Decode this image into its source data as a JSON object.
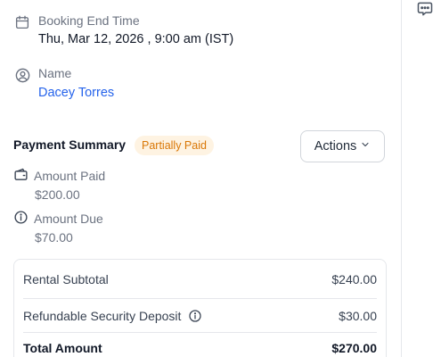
{
  "booking": {
    "end_time_label": "Booking End Time",
    "end_time_value": "Thu, Mar 12, 2026 , 9:00 am (IST)",
    "name_label": "Name",
    "name_value": "Dacey Torres"
  },
  "payment_summary": {
    "title": "Payment Summary",
    "status_badge": "Partially Paid",
    "actions_label": "Actions",
    "amount_paid_label": "Amount Paid",
    "amount_paid_value": "$200.00",
    "amount_due_label": "Amount Due",
    "amount_due_value": "$70.00"
  },
  "totals": {
    "rows": [
      {
        "label": "Rental Subtotal",
        "value": "$240.00"
      },
      {
        "label": "Refundable Security Deposit",
        "value": "$30.00"
      },
      {
        "label": "Total Amount",
        "value": "$270.00"
      }
    ]
  },
  "icons": {
    "calendar": "calendar-icon",
    "user": "user-circle-icon",
    "wallet": "wallet-icon",
    "info": "info-icon",
    "chevron": "chevron-down-icon",
    "chat": "chat-icon"
  },
  "colors": {
    "link": "#2563eb",
    "badge_bg": "#fef3e2",
    "badge_text": "#d97706"
  }
}
